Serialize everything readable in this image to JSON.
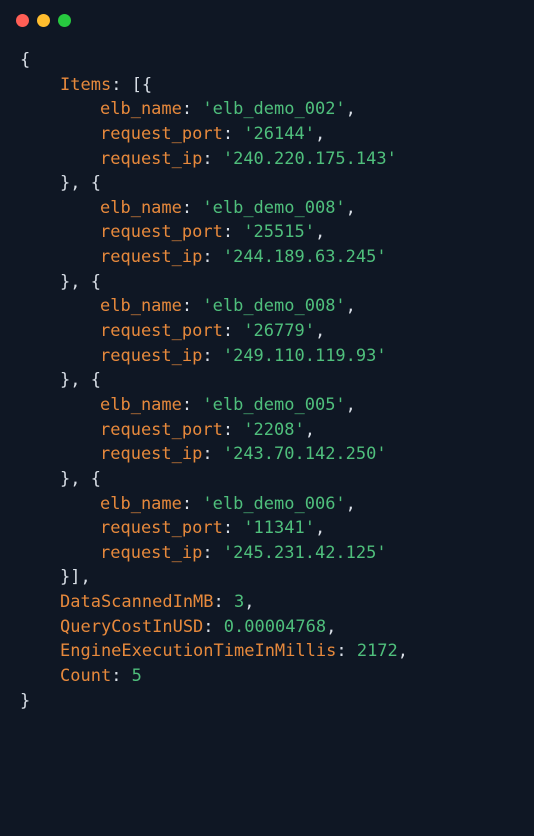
{
  "titlebar": {
    "red": "close",
    "yellow": "minimize",
    "green": "zoom"
  },
  "code": {
    "items_key": "Items",
    "prop_elb": "elb_name",
    "prop_port": "request_port",
    "prop_ip": "request_ip",
    "items": [
      {
        "elb_name": "elb_demo_002",
        "request_port": "26144",
        "request_ip": "240.220.175.143"
      },
      {
        "elb_name": "elb_demo_008",
        "request_port": "25515",
        "request_ip": "244.189.63.245"
      },
      {
        "elb_name": "elb_demo_008",
        "request_port": "26779",
        "request_ip": "249.110.119.93"
      },
      {
        "elb_name": "elb_demo_005",
        "request_port": "2208",
        "request_ip": "243.70.142.250"
      },
      {
        "elb_name": "elb_demo_006",
        "request_port": "11341",
        "request_ip": "245.231.42.125"
      }
    ],
    "datascanned_key": "DataScannedInMB",
    "datascanned_val": "3",
    "querycost_key": "QueryCostInUSD",
    "querycost_val": "0.00004768",
    "exectime_key": "EngineExecutionTimeInMillis",
    "exectime_val": "2172",
    "count_key": "Count",
    "count_val": "5"
  }
}
